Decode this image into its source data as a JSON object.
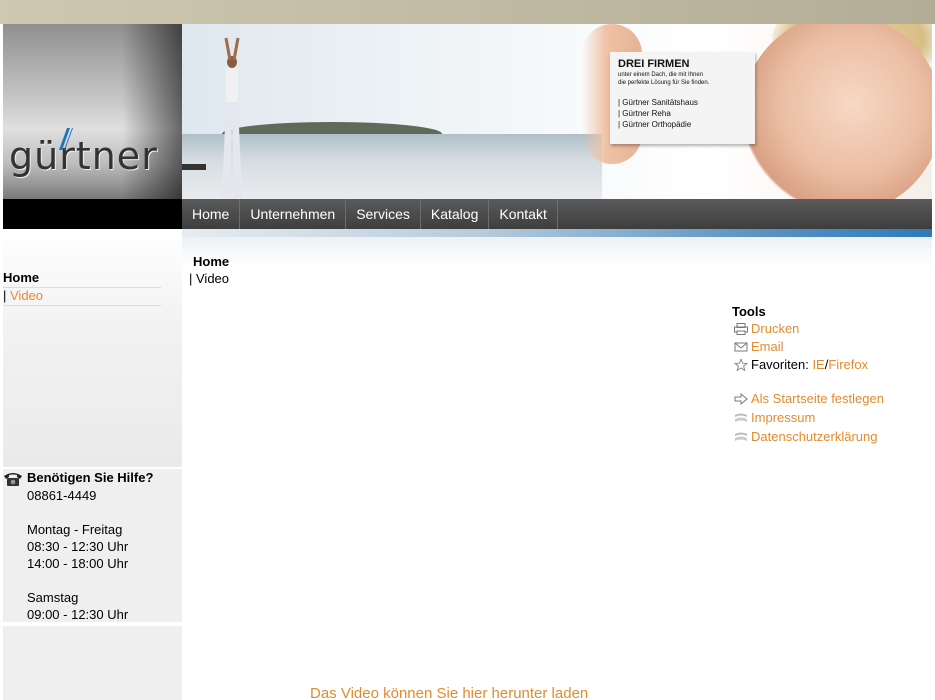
{
  "brand": {
    "logo_text": "gürtner"
  },
  "banner": {
    "card_title": "DREI FIRMEN",
    "card_subtitle_line1": "unter einem Dach, die mit Ihnen",
    "card_subtitle_line2": "die perfekte Lösung für Sie finden.",
    "card_items": [
      "| Gürtner Sanitätshaus",
      "| Gürtner Reha",
      "| Gürtner Orthopädie"
    ]
  },
  "nav": {
    "items": [
      {
        "label": "Home"
      },
      {
        "label": "Unternehmen"
      },
      {
        "label": "Services"
      },
      {
        "label": "Katalog"
      },
      {
        "label": "Kontakt"
      }
    ]
  },
  "sidebar": {
    "home_label": "Home",
    "video_prefix": "| ",
    "video_label": "Video"
  },
  "help": {
    "title": "Benötigen Sie Hilfe?",
    "phone": "08861-4449",
    "weekday_label": "Montag - Freitag",
    "weekday_hours_1": "08:30 - 12:30 Uhr",
    "weekday_hours_2": "14:00 - 18:00 Uhr",
    "saturday_label": "Samstag",
    "saturday_hours": "09:00 - 12:30 Uhr"
  },
  "breadcrumb": {
    "home": "Home",
    "current": "| Video"
  },
  "tools": {
    "title": "Tools",
    "print_label": "Drucken",
    "email_label": "Email",
    "favorites_label": "Favoriten: ",
    "favorites_ie": "IE",
    "favorites_sep": " / ",
    "favorites_firefox": "Firefox",
    "startpage_label": "Als Startseite festlegen",
    "impressum_label": "Impressum",
    "privacy_label": "Datenschutzerklärung"
  },
  "main": {
    "download_link": "Das Video können Sie hier herunter laden"
  },
  "colors": {
    "link": "#e38b2e",
    "nav_bg": "#4a4a4a",
    "accent_blue": "#2f7ab8"
  }
}
